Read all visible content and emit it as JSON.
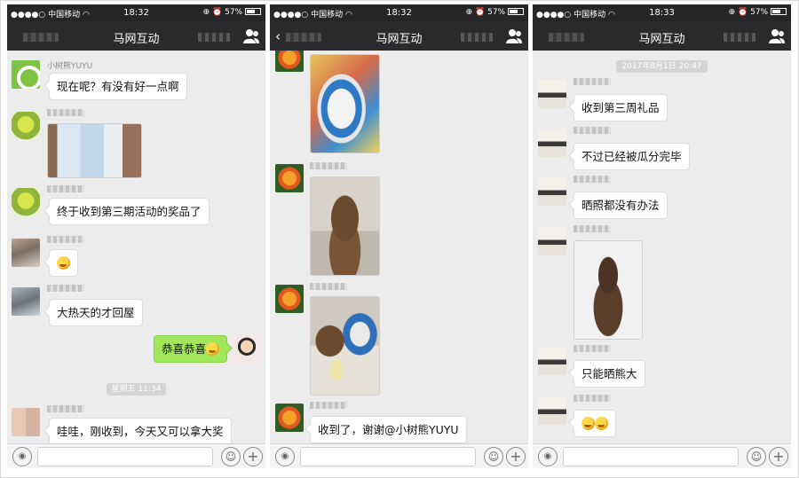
{
  "panels": [
    {
      "status": {
        "signal": "●●●●○",
        "carrier": "中国移动",
        "time": "18:32",
        "battery_text": "57%"
      },
      "nav": {
        "back": "",
        "title": "马网互动"
      },
      "messages": [
        {
          "sender": "小树熊YUYU",
          "text": "现在呢？有没有好一点啊"
        },
        {
          "text": "终于收到第三期活动的奖品了"
        },
        {
          "text": "大热天的才回屋"
        },
        {
          "text": "恭喜恭喜"
        },
        {
          "timestamp": "星期五 11:34"
        },
        {
          "text": "哇哇，刚收到，今天又可以拿大奖"
        }
      ]
    },
    {
      "status": {
        "signal": "●●●●○",
        "carrier": "中国移动",
        "time": "18:32",
        "battery_text": "57%"
      },
      "nav": {
        "back": "‹",
        "title": "马网互动"
      },
      "messages": [
        {
          "text": "收到了，谢谢@小树熊YUYU"
        }
      ]
    },
    {
      "status": {
        "signal": "●●●●○",
        "carrier": "中国移动",
        "time": "18:33",
        "battery_text": "57%"
      },
      "nav": {
        "back": "",
        "title": "马网互动"
      },
      "messages": [
        {
          "timestamp": "2017年8月1日 20:47"
        },
        {
          "text": "收到第三周礼品"
        },
        {
          "text": "不过已经被瓜分完毕"
        },
        {
          "text": "晒照都没有办法"
        },
        {
          "text": "只能晒熊大"
        }
      ]
    }
  ],
  "icons": {
    "wifi": "wifi-icon",
    "alarm": "alarm-icon",
    "lock": "orientation-lock-icon",
    "people": "group-chat-icon",
    "voice": "voice-input-icon",
    "emoji": "emoji-icon",
    "plus": "plus-icon"
  },
  "colors": {
    "navbar": "#2b2b2d",
    "chat_background": "#ececec",
    "sent_bubble": "#a0e75a",
    "received_bubble": "#ffffff"
  }
}
